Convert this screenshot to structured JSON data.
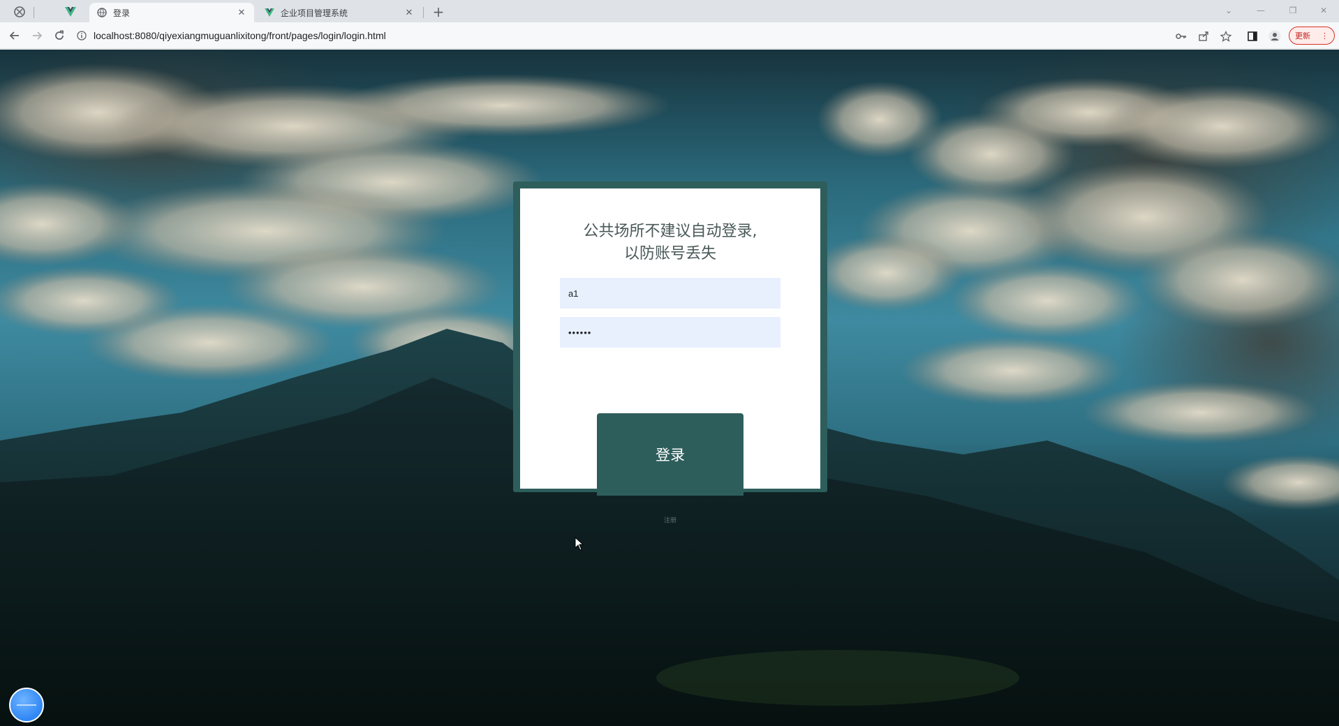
{
  "browser": {
    "tabs": [
      {
        "title": "",
        "favicon": "vue-logo-icon",
        "active": false
      },
      {
        "title": "登录",
        "favicon": "globe-icon",
        "active": true
      },
      {
        "title": "企业项目管理系统",
        "favicon": "vue-logo-icon",
        "active": false
      }
    ],
    "url": "localhost:8080/qiyexiangmuguanlixitong/front/pages/login/login.html",
    "update_label": "更新"
  },
  "login": {
    "title_line1": "公共场所不建议自动登录,",
    "title_line2": "以防账号丢失",
    "username_value": "a1",
    "password_value": "••••••",
    "login_button": "登录",
    "register_link": "注册"
  },
  "colors": {
    "accent": "#2e5e5c",
    "input_bg": "#e8f0fe",
    "title_text": "#4a5858"
  }
}
